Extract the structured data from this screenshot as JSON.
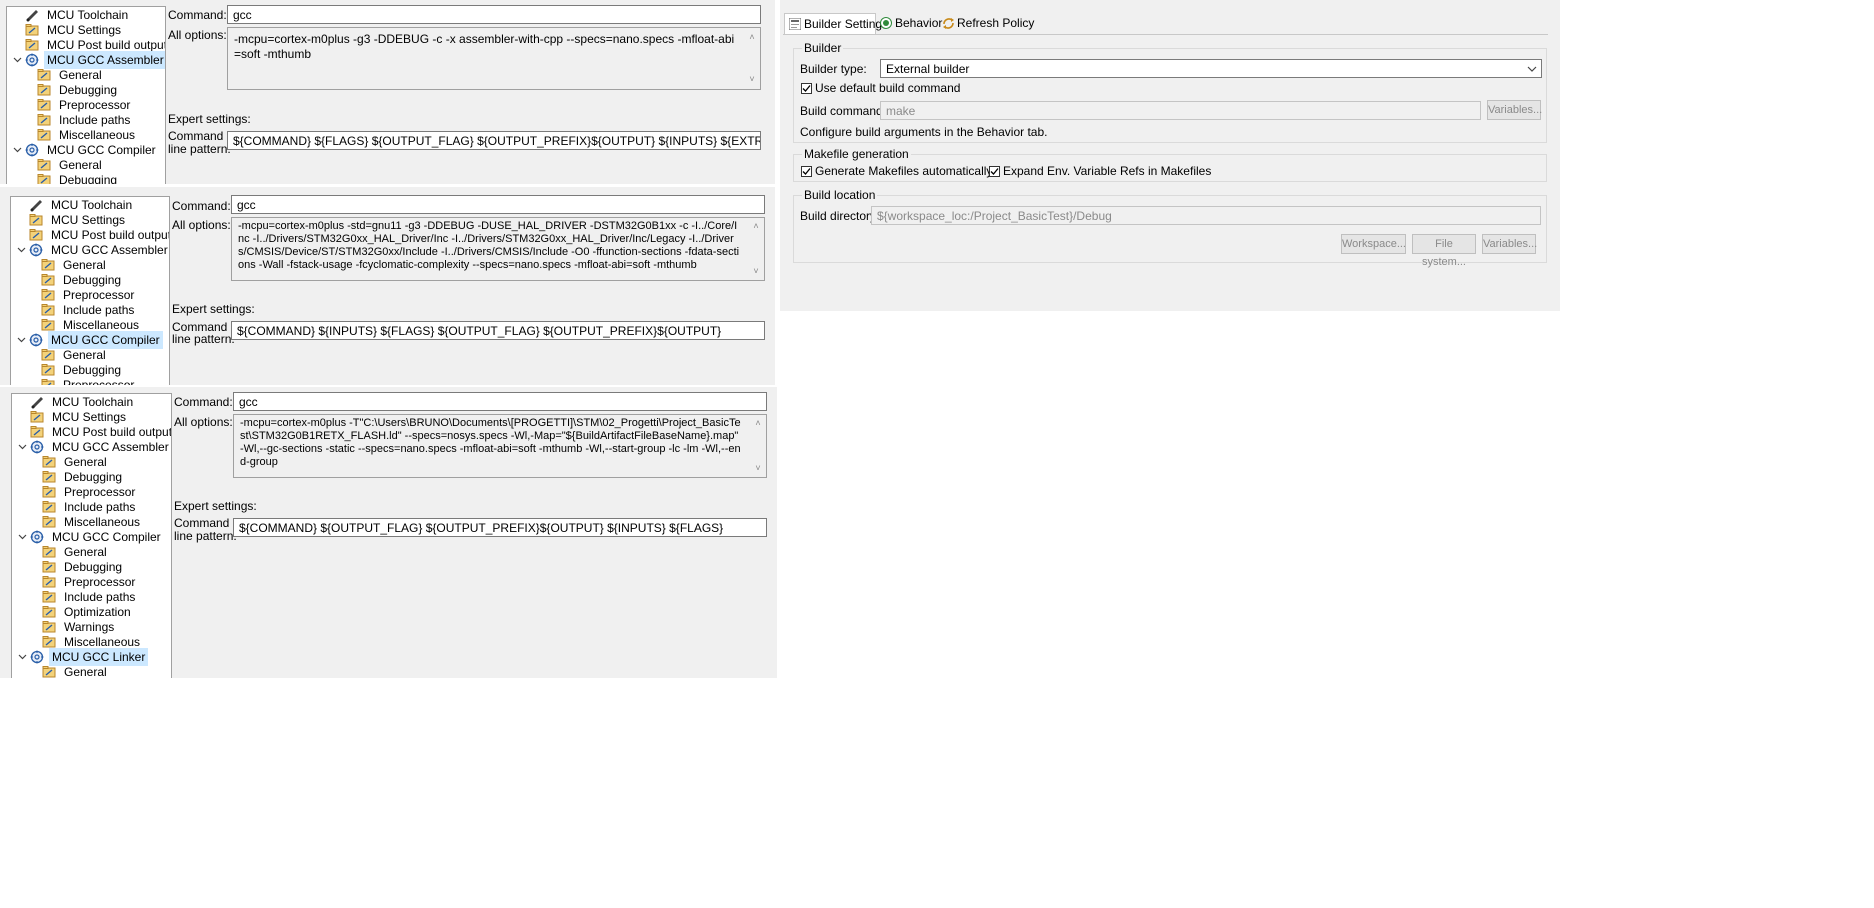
{
  "tool_settings": {
    "command_label": "Command:",
    "all_options_label": "All options:",
    "expert_settings_label": "Expert settings:",
    "command_line_label_1": "Command",
    "command_line_label_2": "line pattern:"
  },
  "panel1": {
    "tree": [
      "MCU Toolchain",
      "MCU Settings",
      "MCU Post build outputs",
      "MCU GCC Assembler",
      "General",
      "Debugging",
      "Preprocessor",
      "Include paths",
      "Miscellaneous",
      "MCU GCC Compiler",
      "General",
      "Debugging"
    ],
    "command": "gcc",
    "all_options": "-mcpu=cortex-m0plus -g3 -DDEBUG -c -x assembler-with-cpp --specs=nano.specs -mfloat-abi=soft -mthumb",
    "pattern": "${COMMAND} ${FLAGS} ${OUTPUT_FLAG} ${OUTPUT_PREFIX}${OUTPUT} ${INPUTS} ${EXTRA_FLAGS}"
  },
  "panel2": {
    "tree": [
      "MCU Toolchain",
      "MCU Settings",
      "MCU Post build outputs",
      "MCU GCC Assembler",
      "General",
      "Debugging",
      "Preprocessor",
      "Include paths",
      "Miscellaneous",
      "MCU GCC Compiler",
      "General",
      "Debugging",
      "Preprocessor"
    ],
    "command": "gcc",
    "all_options": "-mcpu=cortex-m0plus -std=gnu11 -g3 -DDEBUG -DUSE_HAL_DRIVER -DSTM32G0B1xx -c -I../Core/Inc -I../Drivers/STM32G0xx_HAL_Driver/Inc -I../Drivers/STM32G0xx_HAL_Driver/Inc/Legacy -I../Drivers/CMSIS/Device/ST/STM32G0xx/Include -I../Drivers/CMSIS/Include -O0 -ffunction-sections -fdata-sections -Wall -fstack-usage -fcyclomatic-complexity --specs=nano.specs -mfloat-abi=soft -mthumb",
    "pattern": "${COMMAND} ${INPUTS} ${FLAGS} ${OUTPUT_FLAG} ${OUTPUT_PREFIX}${OUTPUT}"
  },
  "panel3": {
    "tree": [
      "MCU Toolchain",
      "MCU Settings",
      "MCU Post build outputs",
      "MCU GCC Assembler",
      "General",
      "Debugging",
      "Preprocessor",
      "Include paths",
      "Miscellaneous",
      "MCU GCC Compiler",
      "General",
      "Debugging",
      "Preprocessor",
      "Include paths",
      "Optimization",
      "Warnings",
      "Miscellaneous",
      "MCU GCC Linker",
      "General"
    ],
    "command": "gcc",
    "all_options": "-mcpu=cortex-m0plus -T\"C:\\Users\\BRUNO\\Documents\\[PROGETTI]\\STM\\02_Progetti\\Project_BasicTest\\STM32G0B1RETX_FLASH.ld\" --specs=nosys.specs -Wl,-Map=\"${BuildArtifactFileBaseName}.map\" -Wl,--gc-sections -static --specs=nano.specs -mfloat-abi=soft -mthumb -Wl,--start-group -lc -lm -Wl,--end-group",
    "pattern": "${COMMAND} ${OUTPUT_FLAG} ${OUTPUT_PREFIX}${OUTPUT} ${INPUTS} ${FLAGS}"
  },
  "builder": {
    "tabs": [
      "Builder Settings",
      "Behavior",
      "Refresh Policy"
    ],
    "builder_group": "Builder",
    "builder_type_label": "Builder type:",
    "builder_type_value": "External builder",
    "use_default_label": "Use default build command",
    "build_command_label": "Build command:",
    "build_command_value": "make",
    "variables_label": "Variables...",
    "configure_note": "Configure build arguments in the Behavior tab.",
    "makefile_group": "Makefile generation",
    "generate_makefiles_label": "Generate Makefiles automatically",
    "expand_env_label": "Expand Env. Variable Refs in Makefiles",
    "location_group": "Build location",
    "build_directory_label": "Build directory:",
    "build_directory_value": "${workspace_loc:/Project_BasicTest}/Debug",
    "workspace_btn": "Workspace...",
    "filesystem_btn": "File system...",
    "variables_btn2": "Variables..."
  }
}
